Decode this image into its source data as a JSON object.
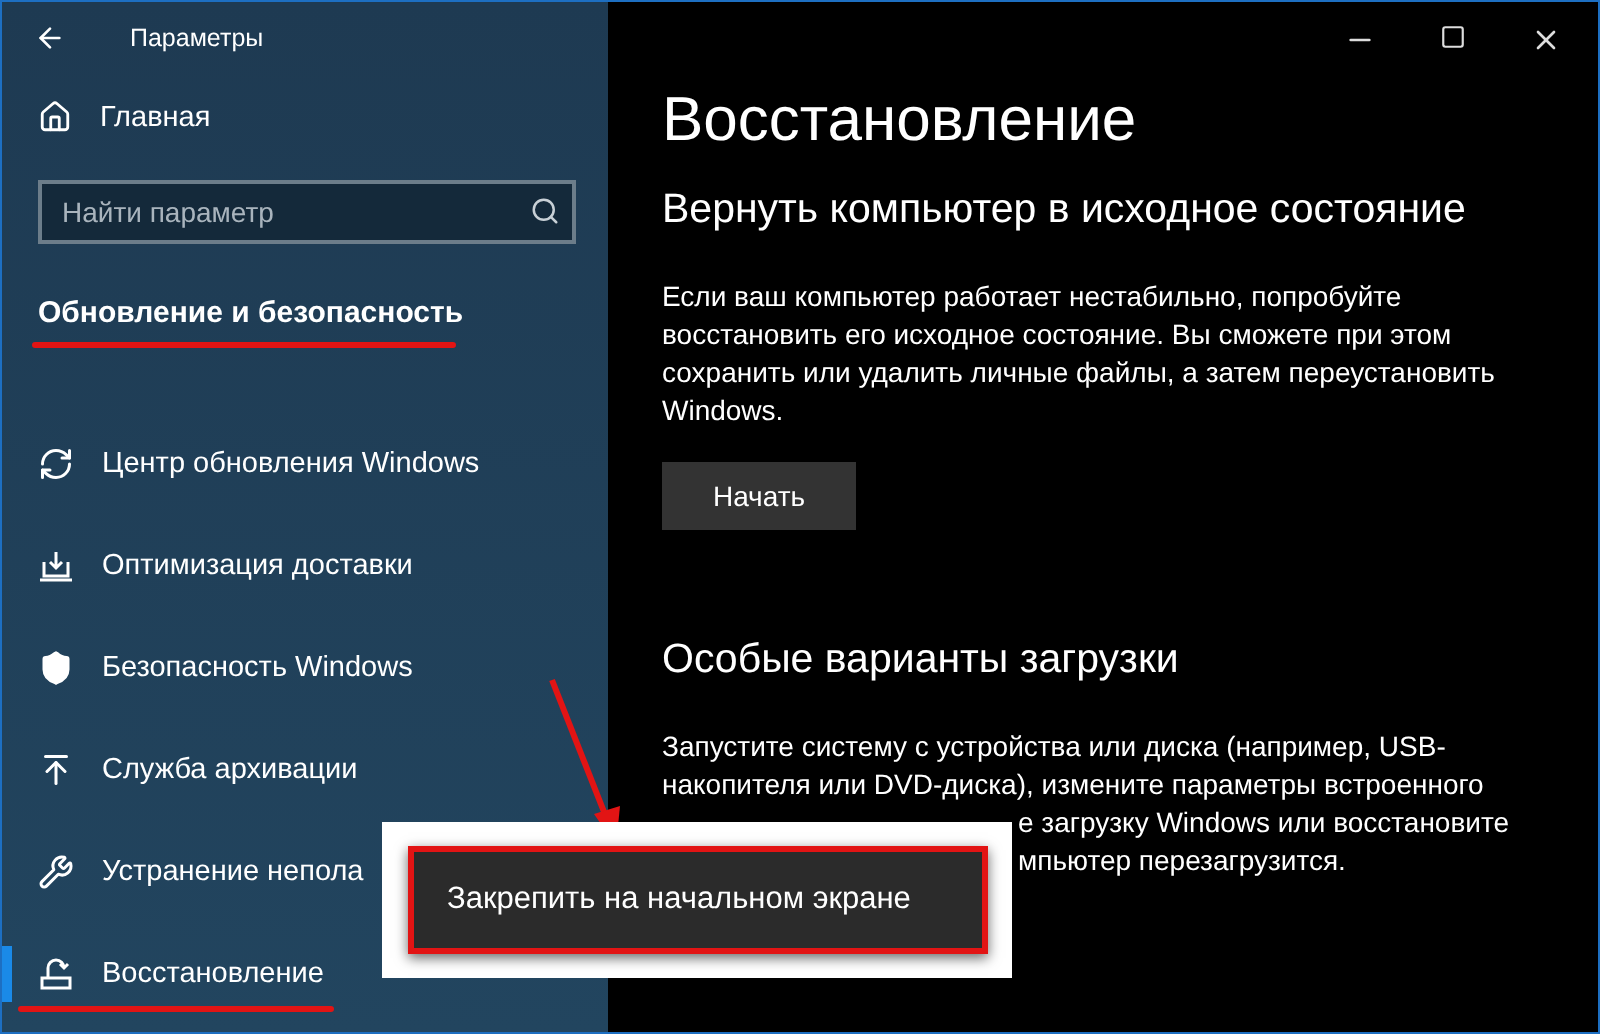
{
  "window": {
    "title": "Параметры"
  },
  "sidebar": {
    "home": "Главная",
    "search": {
      "placeholder": "Найти параметр"
    },
    "section_title": {
      "text": "Обновление и безопасность",
      "underlined": true
    },
    "items": [
      {
        "label": "Центр обновления Windows",
        "kind": "refresh",
        "selected": false,
        "underlined": false
      },
      {
        "label": "Оптимизация доставки",
        "kind": "delivery",
        "selected": false,
        "underlined": false
      },
      {
        "label": "Безопасность Windows",
        "kind": "shield",
        "selected": false,
        "underlined": false
      },
      {
        "label": "Служба архивации",
        "kind": "backup",
        "selected": false,
        "underlined": false
      },
      {
        "label": "Устранение непола",
        "kind": "wrench",
        "selected": false,
        "underlined": false
      },
      {
        "label": "Восстановление",
        "kind": "recovery",
        "selected": true,
        "underlined": true
      }
    ]
  },
  "main": {
    "title": "Восстановление",
    "sections": [
      {
        "heading": "Вернуть компьютер в исходное состояние",
        "lines": [
          {
            "text": "Если ваш компьютер работает нестабильно, попробуйте",
            "kind": "full"
          },
          {
            "text": "восстановить его исходное состояние. Вы сможете при этом",
            "kind": "full"
          },
          {
            "text": "сохранить или удалить личные файлы, а затем переустановить",
            "kind": "full"
          },
          {
            "text": "Windows.",
            "kind": "full"
          }
        ],
        "button": "Начать"
      },
      {
        "heading": "Особые варианты загрузки",
        "lines": [
          {
            "text": "Запустите систему с устройства или диска (например, USB-",
            "kind": "full"
          },
          {
            "text": "накопителя или DVD-диска), измените параметры встроенного",
            "kind": "full"
          },
          {
            "text": "е загрузку Windows или восстановите",
            "kind": "covered"
          },
          {
            "text": "мпьютер перезагрузится.",
            "kind": "covered"
          }
        ]
      }
    ]
  },
  "context_menu": {
    "items": [
      "Закрепить на начальном экране"
    ],
    "pointer_arrow": true
  }
}
